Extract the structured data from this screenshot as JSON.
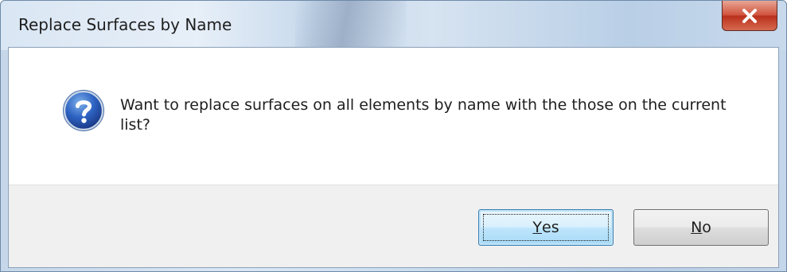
{
  "window": {
    "title": "Replace Surfaces by Name"
  },
  "titlebar": {
    "close_icon": "close-icon"
  },
  "dialog": {
    "icon": "question-icon",
    "message": "Want to replace surfaces on all elements by name with the those on the current list?"
  },
  "buttons": {
    "yes": {
      "mnemonic": "Y",
      "rest": "es"
    },
    "no": {
      "mnemonic": "N",
      "rest": "o"
    }
  },
  "colors": {
    "close_button": "#c7432d",
    "default_button_border": "#3c7fb1",
    "footer_background": "#f0f0f0"
  }
}
